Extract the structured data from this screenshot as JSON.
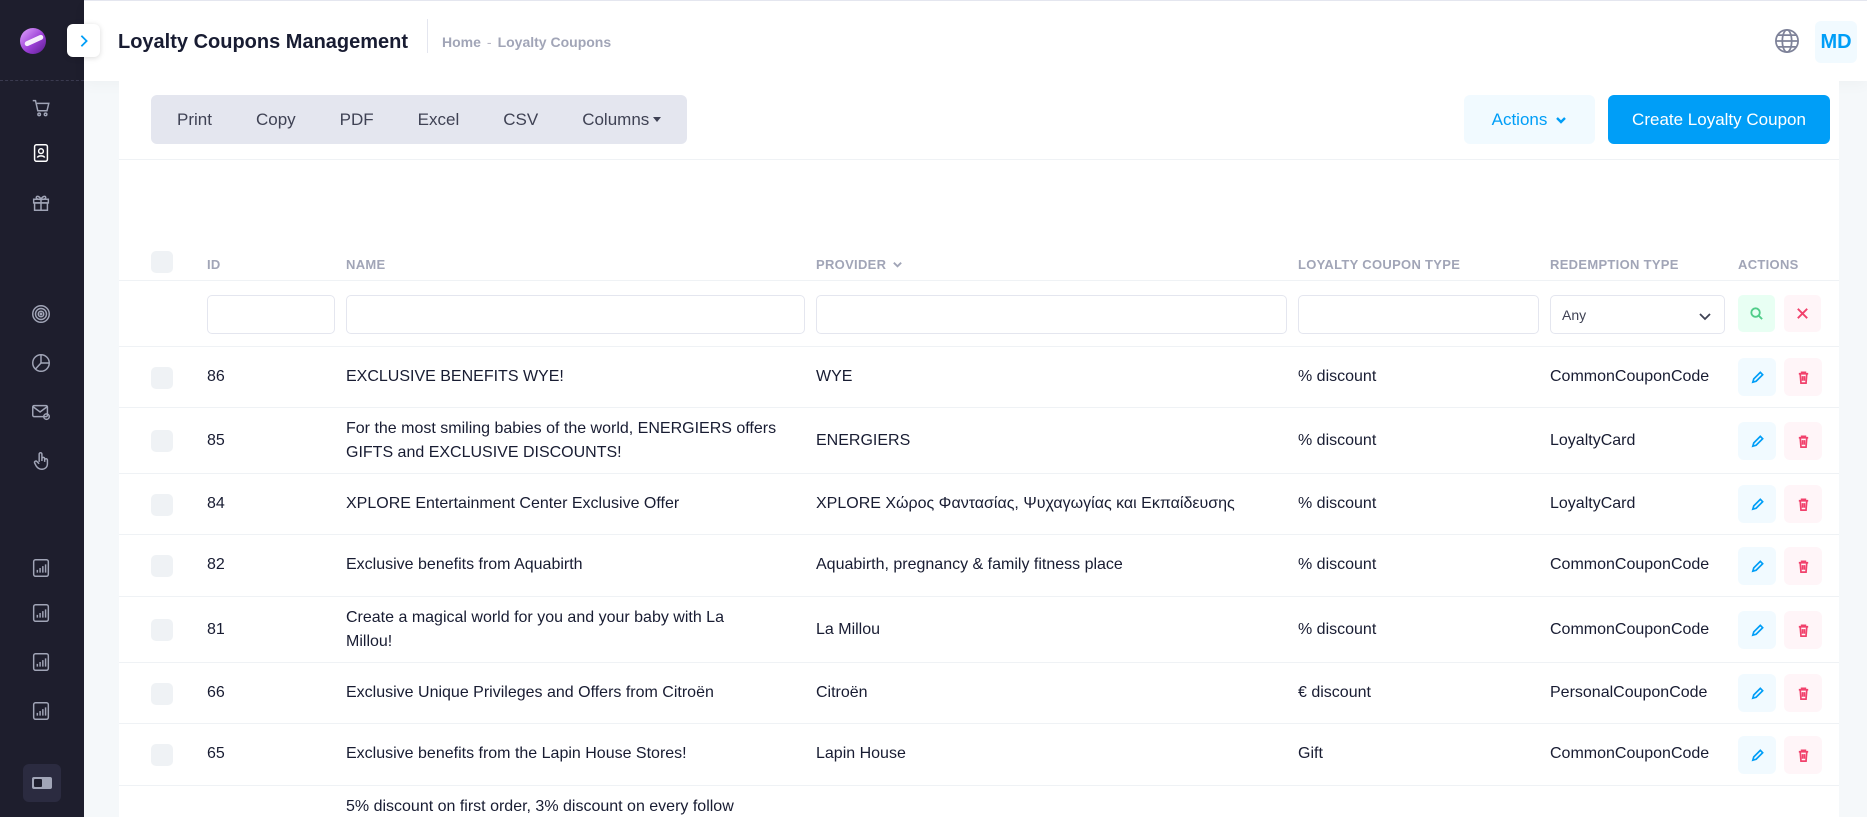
{
  "header": {
    "title": "Loyalty Coupons Management",
    "breadcrumb": [
      "Home",
      "Loyalty Coupons"
    ],
    "breadcrumb_sep": "-",
    "avatar_initials": "MD"
  },
  "sidebar": {
    "icons": [
      "cart-icon",
      "contact-card-icon",
      "gift-icon",
      "target-icon",
      "pie-chart-icon",
      "mail-settings-icon",
      "hand-pointer-icon",
      "report-icon",
      "report-icon",
      "report-icon",
      "report-icon"
    ],
    "active_icon": "contact-card-icon"
  },
  "toolbar": {
    "export_buttons": [
      "Print",
      "Copy",
      "PDF",
      "Excel",
      "CSV"
    ],
    "columns_label": "Columns",
    "actions_label": "Actions",
    "create_label": "Create Loyalty Coupon"
  },
  "table": {
    "columns": {
      "id": "ID",
      "name": "NAME",
      "provider": "PROVIDER",
      "coupon_type": "LOYALTY COUPON TYPE",
      "redemption_type": "REDEMPTION TYPE",
      "actions": "ACTIONS"
    },
    "filter_redemption_value": "Any",
    "rows": [
      {
        "id": "86",
        "name": "EXCLUSIVE BENEFITS WYE!",
        "provider": "WYE",
        "type": "% discount",
        "redemption": "CommonCouponCode"
      },
      {
        "id": "85",
        "name": "For the most smiling babies of the world, ENERGIERS offers GIFTS and EXCLUSIVE DISCOUNTS!",
        "provider": "ENERGIERS",
        "type": "% discount",
        "redemption": "LoyaltyCard"
      },
      {
        "id": "84",
        "name": "XPLORE Entertainment Center Exclusive Offer",
        "provider": "XPLORE Χώρος Φαντασίας, Ψυχαγωγίας και Εκπαίδευσης",
        "type": "% discount",
        "redemption": "LoyaltyCard"
      },
      {
        "id": "82",
        "name": "Exclusive benefits from Aquabirth",
        "provider": "Aquabirth, pregnancy & family fitness place",
        "type": "% discount",
        "redemption": "CommonCouponCode"
      },
      {
        "id": "81",
        "name": "Create a magical world for you and your baby with La Millou!",
        "provider": "La Millou",
        "type": "% discount",
        "redemption": "CommonCouponCode"
      },
      {
        "id": "66",
        "name": "Exclusive Unique Privileges and Offers from Citroën",
        "provider": "Citroën",
        "type": "€ discount",
        "redemption": "PersonalCouponCode"
      },
      {
        "id": "65",
        "name": "Exclusive benefits from the Lapin House Stores!",
        "provider": "Lapin House",
        "type": "Gift",
        "redemption": "CommonCouponCode"
      },
      {
        "id": "",
        "name": "5% discount on first order, 3% discount on every follow",
        "provider": "",
        "type": "",
        "redemption": ""
      }
    ]
  }
}
